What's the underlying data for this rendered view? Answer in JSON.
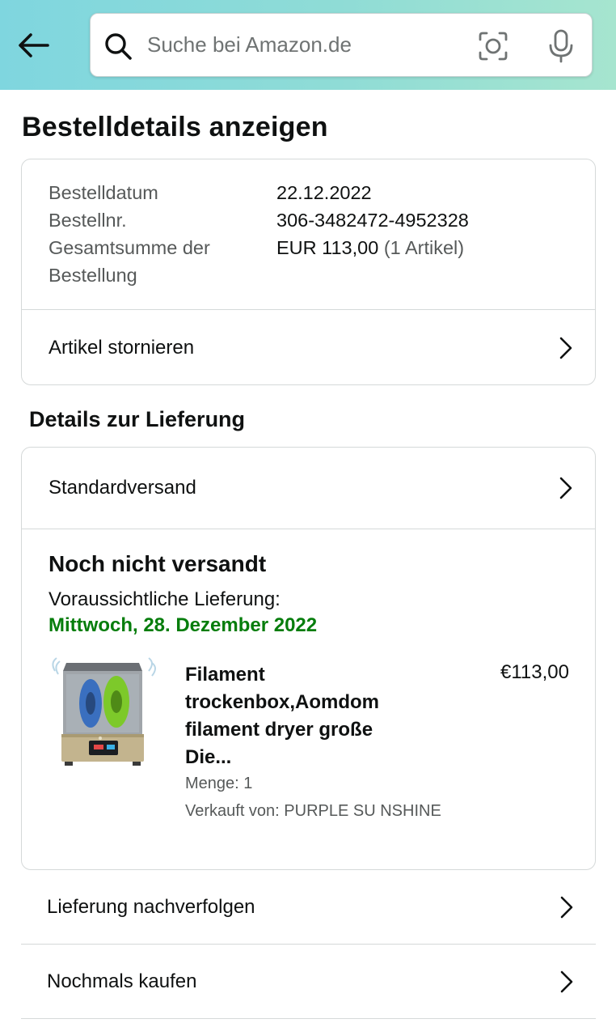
{
  "search": {
    "placeholder": "Suche bei Amazon.de"
  },
  "page_title": "Bestelldetails anzeigen",
  "order": {
    "date_label": "Bestelldatum",
    "date_value": "22.12.2022",
    "number_label": "Bestellnr.",
    "number_value": "306-3482472-4952328",
    "total_label": "Gesamtsumme der Bestellung",
    "total_value": "EUR 113,00",
    "total_items": "(1 Artikel)",
    "cancel_label": "Artikel stornieren"
  },
  "delivery": {
    "section_title": "Details zur Lieferung",
    "shipping_method": "Standardversand",
    "status": "Noch nicht versandt",
    "expected_label": "Voraussichtliche Lieferung:",
    "expected_date": "Mittwoch, 28. Dezember 2022",
    "product": {
      "title": "Filament trockenbox,Aomdom filament dryer große Die...",
      "price": "€113,00",
      "quantity": "Menge: 1",
      "seller": "Verkauft von: PURPLE SU NSHINE"
    }
  },
  "actions": {
    "track": "Lieferung nachverfolgen",
    "buy_again": "Nochmals kaufen"
  },
  "colors": {
    "header_gradient_start": "#7fd6df",
    "header_gradient_end": "#a6e5cf",
    "delivery_date_green": "#067d0c",
    "muted_text": "#565959"
  },
  "icons": [
    "back-arrow-icon",
    "search-icon",
    "camera-scan-icon",
    "microphone-icon",
    "chevron-right-icon"
  ]
}
